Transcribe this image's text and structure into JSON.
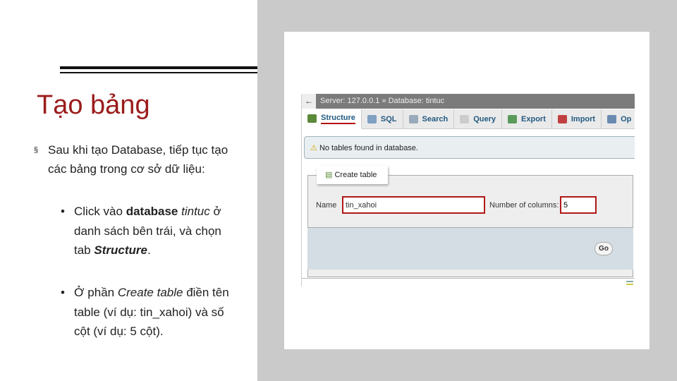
{
  "slide": {
    "title": "Tạo bảng",
    "bullet1": "Sau khi tạo Database, tiếp tục tạo các bảng trong cơ sở dữ liệu:",
    "bullet1_marker": "§",
    "sub1": {
      "a": "Click vào ",
      "b": "database ",
      "c": "tintuc",
      "d": " ở danh sách bên trái, và chọn tab ",
      "e": "Structure",
      "f": "."
    },
    "sub2": {
      "a": "Ở phần ",
      "b": "Create table",
      "c": " điền tên table (ví dụ: tin_xahoi) và số cột (ví dụ: 5 cột)."
    },
    "sub_marker": "•"
  },
  "screenshot": {
    "breadcrumb": "Server: 127.0.0.1 » Database: tintuc",
    "tabs": [
      {
        "label": "Structure",
        "color": "#5a8a3a"
      },
      {
        "label": "SQL",
        "color": "#7fa0c0"
      },
      {
        "label": "Search",
        "color": "#9ab"
      },
      {
        "label": "Query",
        "color": "#ccc"
      },
      {
        "label": "Export",
        "color": "#5a9a5a"
      },
      {
        "label": "Import",
        "color": "#c04040"
      },
      {
        "label": "Op",
        "color": "#6a8ab0"
      }
    ],
    "notice": "No tables found in database.",
    "create_table": "Create table",
    "name_label": "Name",
    "name_value": "tin_xahoi",
    "columns_label": "Number of columns:",
    "columns_value": "5",
    "go": "Go"
  },
  "colors": {
    "title": "#9b1c1c",
    "highlight": "#b01818",
    "panel": "#c9cac9"
  }
}
